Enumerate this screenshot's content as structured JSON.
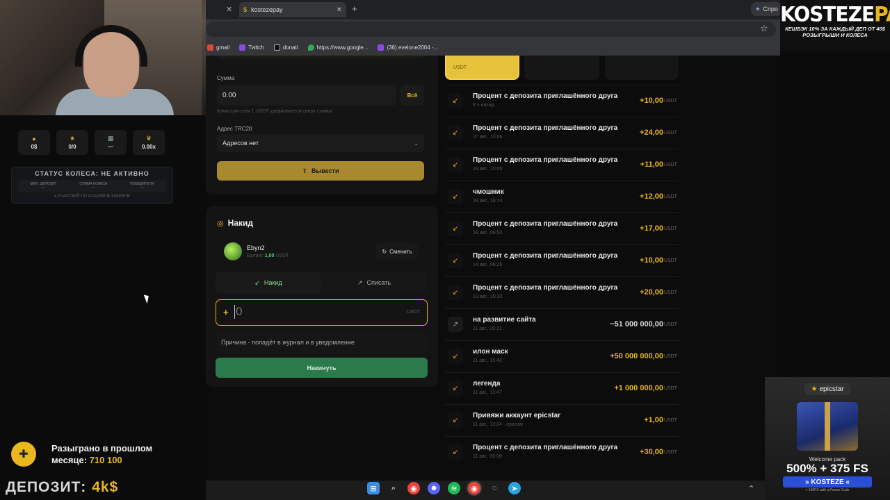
{
  "browser": {
    "tab_title": "kostezepay",
    "spro_label": "Спро",
    "bookmarks": [
      "gmail",
      "Twitch",
      "donati",
      "https://www.google...",
      "(36) evelone2004 -..."
    ]
  },
  "overlay": {
    "logo_main": "KOSTEZE",
    "logo_accent": "PAY",
    "logo_line1": "КЕШБЭК 10% ЗА КАЖДЫЙ ДЕП ОТ 40$",
    "logo_line2": "РОЗЫГРЫШИ И КОЛЕСА",
    "stats": [
      "0$",
      "0/0",
      "—",
      "0.00x"
    ],
    "wheel_title": "СТАТУС КОЛЕСА: НЕ АКТИВНО",
    "wheel_cols": [
      {
        "label": "МИН. ДЕПОЗИТ",
        "value": "—"
      },
      {
        "label": "СУММА КОЛЕСА",
        "value": "—"
      },
      {
        "label": "ПОБЕДИТЕЛИ",
        "value": "—"
      }
    ],
    "wheel_footer": "# УЧАСТВУЙ ПО ССЫЛКЕ В ЗАКРЕПЕ",
    "raffled_text": "Разыграно в прошлом месяце:",
    "raffled_amount": "710 100",
    "deposit_label": "ДЕПОЗИТ:",
    "deposit_value": "4k$"
  },
  "withdraw": {
    "sum_label": "Сумма",
    "sum_value": "0.00",
    "all_button": "Всё",
    "fee_hint": "Комиссия сети 1 USDT удерживается сверх суммы",
    "address_label": "Адрес TRC20",
    "address_value": "Адресов нет",
    "submit_label": "Вывести"
  },
  "nakid": {
    "title": "Накид",
    "user_name": "Ebyn2",
    "balance_label": "Баланс",
    "balance_value": "1,00",
    "balance_currency": "USDT",
    "change_button": "Сменить",
    "tab_add": "Накид",
    "tab_remove": "Списать",
    "amount_prefix": "+",
    "amount_value": "0",
    "amount_currency": "USDT",
    "reason_placeholder": "Причина - попадёт в журнал и в уведомление",
    "submit_label": "Накинуть"
  },
  "wallet_top": {
    "currency": "USDT"
  },
  "transactions": [
    {
      "title": "Процент с депозита приглашённого друга",
      "date": "8 ч назад",
      "amount": "+10,00",
      "currency": "USDT",
      "dir": "in"
    },
    {
      "title": "Процент с депозита приглашённого друга",
      "date": "27 авг., 10:06",
      "amount": "+24,00",
      "currency": "USDT",
      "dir": "in"
    },
    {
      "title": "Процент с депозита приглашённого друга",
      "date": "19 авг., 10:05",
      "amount": "+11,00",
      "currency": "USDT",
      "dir": "in"
    },
    {
      "title": "чмошник",
      "date": "18 авг., 16:14",
      "amount": "+12,00",
      "currency": "USDT",
      "dir": "in"
    },
    {
      "title": "Процент с депозита приглашённого друга",
      "date": "18 авг., 09:50",
      "amount": "+17,00",
      "currency": "USDT",
      "dir": "in"
    },
    {
      "title": "Процент с депозита приглашённого друга",
      "date": "14 авг., 08:26",
      "amount": "+10,00",
      "currency": "USDT",
      "dir": "in"
    },
    {
      "title": "Процент с депозита приглашённого друга",
      "date": "13 авг., 10:30",
      "amount": "+20,00",
      "currency": "USDT",
      "dir": "in"
    },
    {
      "title": "на развитие сайта",
      "date": "11 авг., 20:21",
      "amount": "−51 000 000,00",
      "currency": "USDT",
      "dir": "out"
    },
    {
      "title": "илон маск",
      "date": "11 авг., 15:43",
      "amount": "+50 000 000,00",
      "currency": "USDT",
      "dir": "in"
    },
    {
      "title": "легенда",
      "date": "11 авг., 13:47",
      "amount": "+1 000 000,00",
      "currency": "USDT",
      "dir": "in"
    },
    {
      "title": "Привяжи аккаунт epicstar",
      "date": "11 авг., 13:24 · epicstar",
      "amount": "+1,00",
      "currency": "USDT",
      "dir": "in"
    },
    {
      "title": "Процент с депозита приглашённого друга",
      "date": "11 авг., 00:08",
      "amount": "+30,00",
      "currency": "USDT",
      "dir": "in"
    }
  ],
  "promo": {
    "brand": "epicstar",
    "welcome": "Welcome pack",
    "offer": "500% + 375 FS",
    "code": "» KOSTEZE «",
    "small": "+ 100FS with a Promo Code"
  }
}
